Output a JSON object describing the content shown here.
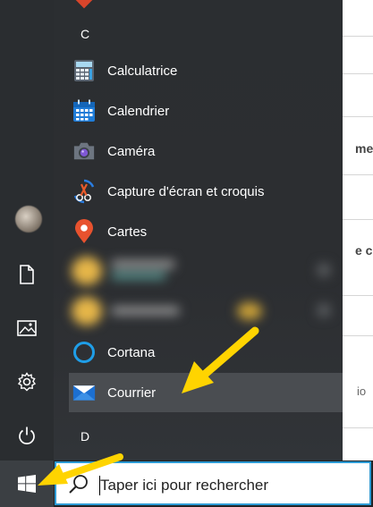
{
  "start_menu": {
    "letters": [
      "C",
      "D"
    ],
    "apps": [
      {
        "label": "Calculatrice",
        "icon": "calculator-icon"
      },
      {
        "label": "Calendrier",
        "icon": "calendar-icon"
      },
      {
        "label": "Caméra",
        "icon": "camera-icon"
      },
      {
        "label": "Capture d'écran et croquis",
        "icon": "snip-sketch-icon"
      },
      {
        "label": "Cartes",
        "icon": "maps-icon"
      },
      {
        "label": "Cortana",
        "icon": "cortana-icon"
      },
      {
        "label": "Courrier",
        "icon": "mail-icon"
      }
    ]
  },
  "rail": {
    "icons": [
      "user-avatar",
      "document-icon",
      "pictures-icon",
      "settings-icon",
      "power-icon"
    ]
  },
  "taskbar": {
    "search_placeholder": "Taper ici pour rechercher",
    "start_icon": "windows-logo-icon"
  },
  "colors": {
    "accent": "#2d9bd5",
    "arrow": "#ffd400",
    "menu_bg": "#2b2e31"
  }
}
